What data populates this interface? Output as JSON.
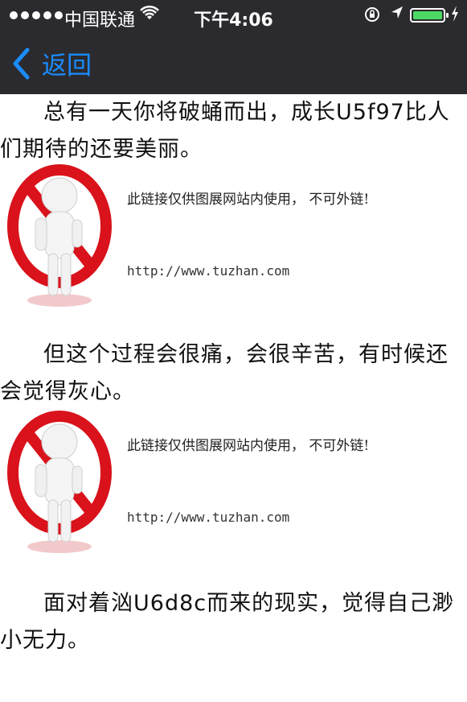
{
  "status_bar": {
    "carrier": "中国联通",
    "time": "下午4:06"
  },
  "nav": {
    "back_label": "返回"
  },
  "article": {
    "paragraph_1": "总有一天你将破蛹而出，成长U5f97比人们期待的还要美丽。",
    "paragraph_2": "但这个过程会很痛，会很辛苦，有时候还会觉得灰心。",
    "paragraph_3": "面对着汹U6d8c而来的现实，觉得自己渺小无力。"
  },
  "watermark": {
    "notice": "此链接仅供图展网站内使用， 不可外链!",
    "url": "http://www.tuzhan.com"
  },
  "colors": {
    "accent": "#1a8cff",
    "nav_background": "#2b2b2f",
    "battery": "#4cd964",
    "prohibit_sign": "#d9121b"
  }
}
